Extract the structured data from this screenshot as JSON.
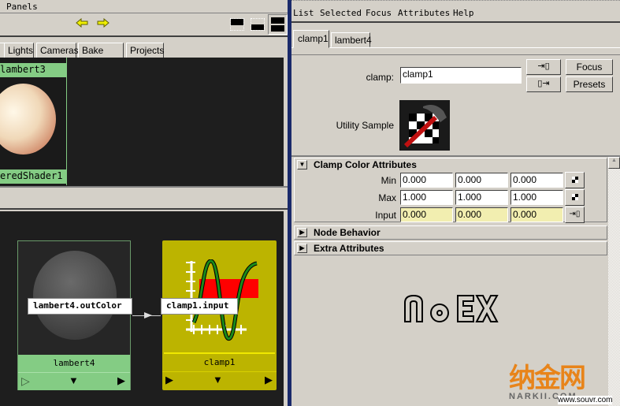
{
  "left_panel": {
    "menu": [
      "Panels"
    ],
    "toolbar": {
      "icons": [
        "arrow-left-icon",
        "arrow-right-icon",
        "layout-top-icon",
        "layout-bottom-icon",
        "layout-split-icon"
      ]
    },
    "tabs": [
      "Lights",
      "Cameras",
      "Bake Sets",
      "Projects"
    ],
    "top_swatches": {
      "header": "lambert3",
      "footer": "eredShader1"
    },
    "graph": {
      "nodes": [
        {
          "name": "lambert4",
          "color": "#84cc84"
        },
        {
          "name": "clamp1",
          "color": "#bcb400"
        }
      ],
      "connection": {
        "from": "lambert4.outColor",
        "to": "clamp1.input"
      }
    }
  },
  "attribute_editor": {
    "menu": [
      "List",
      "Selected",
      "Focus",
      "Attributes",
      "Help"
    ],
    "tabs": [
      "clamp1",
      "lambert4"
    ],
    "active_tab": "clamp1",
    "node_type_label": "clamp:",
    "node_name": "clamp1",
    "buttons": {
      "focus": "Focus",
      "presets": "Presets"
    },
    "sample_label": "Utility Sample",
    "sections": [
      {
        "title": "Clamp Color Attributes",
        "expanded": true,
        "rows": [
          {
            "label": "Min",
            "values": [
              "0.000",
              "0.000",
              "0.000"
            ]
          },
          {
            "label": "Max",
            "values": [
              "1.000",
              "1.000",
              "1.000"
            ]
          },
          {
            "label": "Input",
            "values": [
              "0.000",
              "0.000",
              "0.000"
            ]
          }
        ]
      },
      {
        "title": "Node Behavior",
        "expanded": false
      },
      {
        "title": "Extra Attributes",
        "expanded": false
      }
    ]
  },
  "watermarks": {
    "logo": "NoEX",
    "brand": "纳金网",
    "brand_sub": "NARKII.COM",
    "site": "www.souvr.com"
  }
}
